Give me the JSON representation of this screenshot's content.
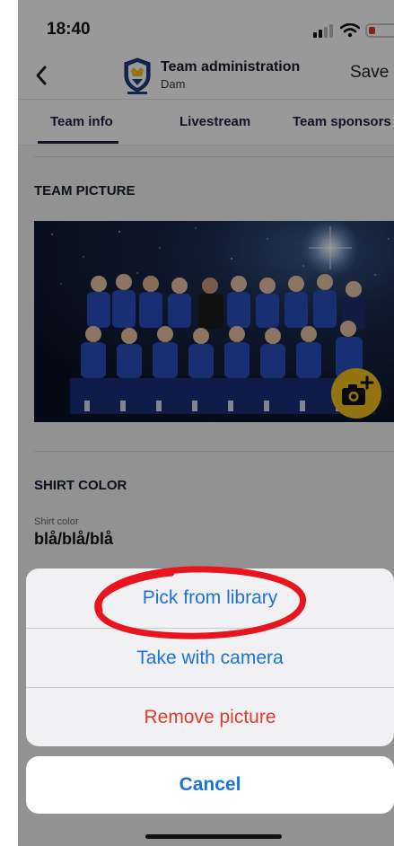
{
  "status_bar": {
    "time": "18:40"
  },
  "header": {
    "title": "Team administration",
    "subtitle": "Dam",
    "save_label": "Save"
  },
  "tabs": [
    {
      "label": "Team info",
      "active": true
    },
    {
      "label": "Livestream",
      "active": false
    },
    {
      "label": "Team sponsors",
      "active": false
    }
  ],
  "team_picture": {
    "heading": "TEAM PICTURE"
  },
  "shirt": {
    "heading": "SHIRT COLOR",
    "field_label": "Shirt color",
    "field_value": "blå/blå/blå"
  },
  "action_sheet": {
    "items": [
      {
        "label": "Pick from library",
        "style": "default"
      },
      {
        "label": "Take with camera",
        "style": "default"
      },
      {
        "label": "Remove picture",
        "style": "destructive"
      }
    ],
    "cancel_label": "Cancel"
  },
  "colors": {
    "accent_blue": "#1a74d8",
    "destructive_red": "#e23b2e",
    "camera_yellow": "#f4c21b",
    "annotation_red": "#e8141e"
  },
  "icons": {
    "back": "chevron-left-icon",
    "camera": "camera-plus-icon",
    "logo": "shield-crown-icon"
  }
}
